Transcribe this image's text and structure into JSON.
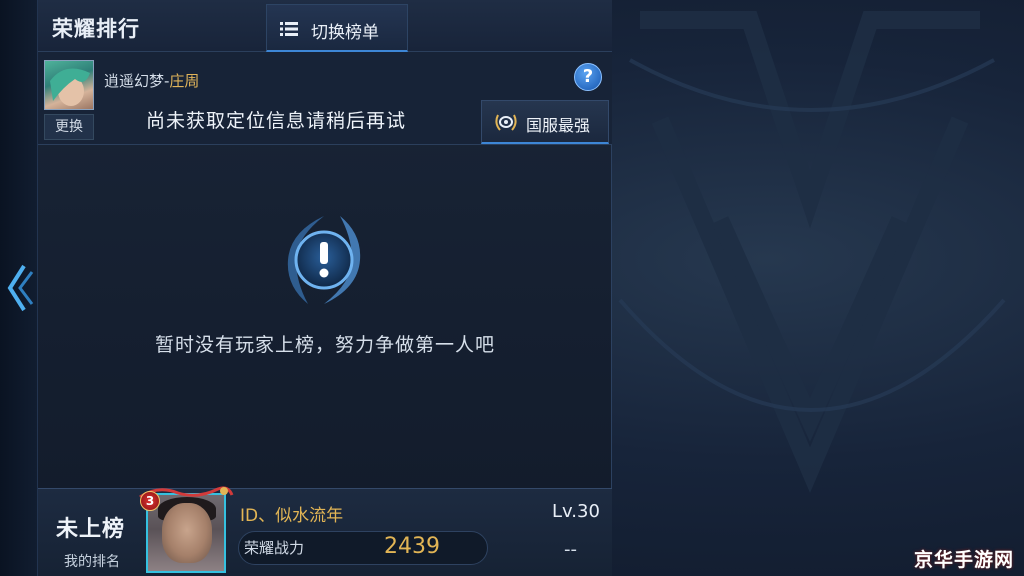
{
  "header": {
    "title": "荣耀排行",
    "switch_label": "切换榜单"
  },
  "user": {
    "hero_name_prefix": "逍遥幻梦-",
    "hero_name": "庄周",
    "change_label": "更换",
    "help_label": "?",
    "location_message": "尚未获取定位信息请稍后再试",
    "server_label": "国服最强"
  },
  "empty_state": {
    "icon": "warning-icon",
    "message": "暂时没有玩家上榜，努力争做第一人吧"
  },
  "my_rank": {
    "status": "未上榜",
    "label": "我的排名",
    "avatar_level": "3",
    "player_name": "ID、似水流年",
    "player_level": "Lv.30",
    "power_label": "荣耀战力",
    "power_value": "2439",
    "power_extra": "--"
  },
  "watermark": "京华手游网",
  "colors": {
    "accent_gold": "#e2b555",
    "accent_blue": "#3d86d6",
    "background": "#17243a"
  }
}
